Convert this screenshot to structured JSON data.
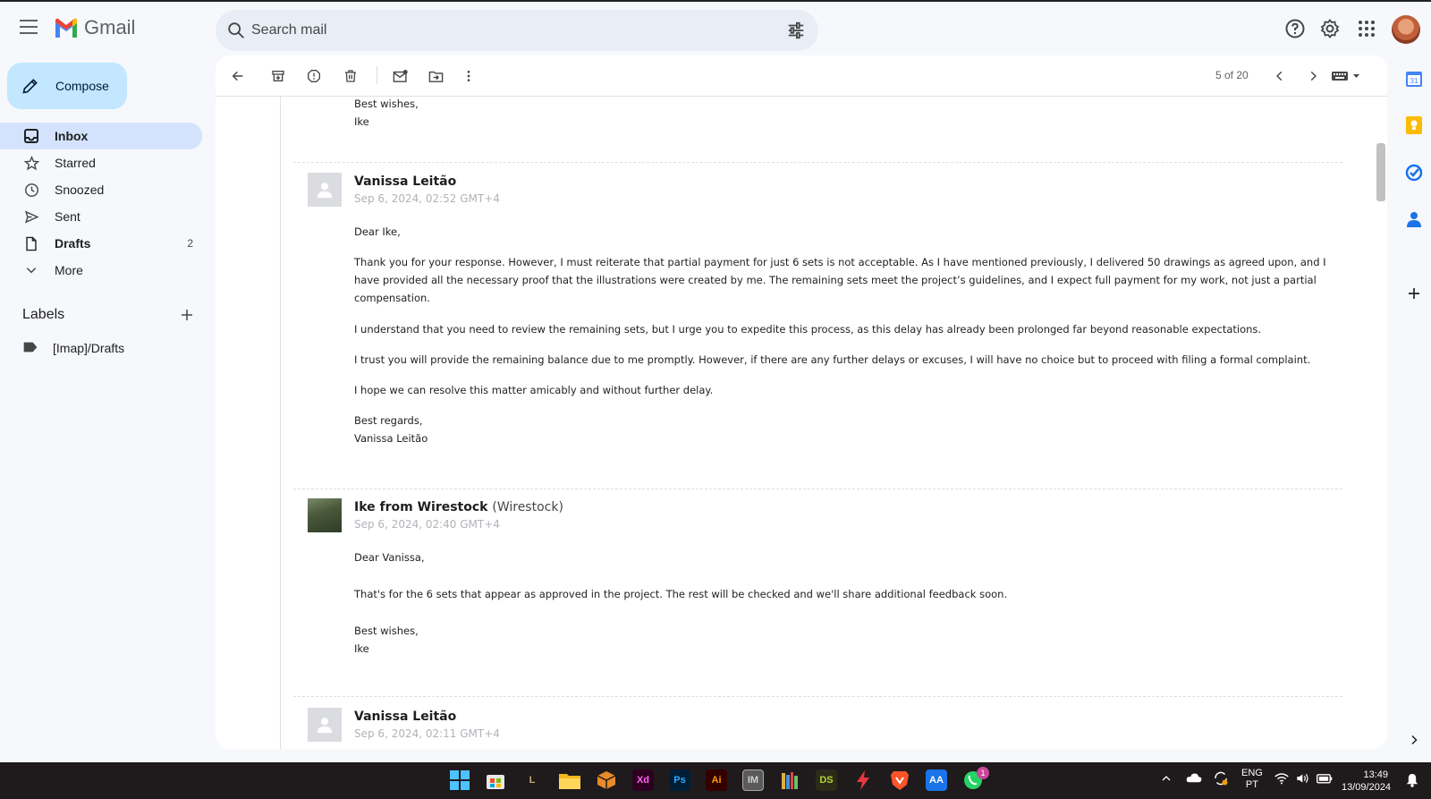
{
  "app": {
    "name": "Gmail"
  },
  "search": {
    "placeholder": "Search mail"
  },
  "compose": {
    "label": "Compose"
  },
  "nav": [
    {
      "label": "Inbox",
      "icon": "inbox-icon",
      "count": ""
    },
    {
      "label": "Starred",
      "icon": "star-icon",
      "count": ""
    },
    {
      "label": "Snoozed",
      "icon": "clock-icon",
      "count": ""
    },
    {
      "label": "Sent",
      "icon": "send-icon",
      "count": ""
    },
    {
      "label": "Drafts",
      "icon": "file-icon",
      "count": "2"
    },
    {
      "label": "More",
      "icon": "chevron-down-icon",
      "count": ""
    }
  ],
  "labels": {
    "title": "Labels",
    "items": [
      {
        "label": "[Imap]/Drafts",
        "icon": "label-icon"
      }
    ]
  },
  "toolbar": {
    "pager": "5 of 20"
  },
  "thread": {
    "top": {
      "closing": "Best wishes,",
      "signature": "Ike"
    },
    "messages": [
      {
        "sender": "Vanissa Leitão",
        "org": "",
        "date": "Sep 6, 2024, 02:52 GMT+4",
        "greeting": "Dear Ike,",
        "paragraphs": [
          "Thank you for your response. However, I must reiterate that partial payment for just 6 sets is not acceptable. As I have mentioned previously, I delivered 50 drawings as agreed upon, and I have provided all the necessary proof that the illustrations were created by me. The remaining sets meet the project’s guidelines, and I expect full payment for my work, not just a partial compensation.",
          "I understand that you need to review the remaining sets, but I urge you to expedite this process, as this delay has already been prolonged far beyond reasonable expectations.",
          "I trust you will provide the remaining balance due to me promptly. However, if there are any further delays or excuses, I will have no choice but to proceed with filing a formal complaint.",
          "I hope we can resolve this matter amicably and without further delay."
        ],
        "closing": "Best regards,",
        "signature": "Vanissa Leitão"
      },
      {
        "sender": "Ike from Wirestock",
        "org": "(Wirestock)",
        "date": "Sep 6, 2024, 02:40 GMT+4",
        "greeting": "Dear Vanissa,",
        "paragraphs": [
          "That's for the 6 sets that appear as approved in the project. The rest will be checked and we'll share additional feedback soon."
        ],
        "closing": "Best wishes,",
        "signature": "Ike"
      },
      {
        "sender": "Vanissa Leitão",
        "org": "",
        "date": "Sep 6, 2024, 02:11 GMT+4"
      }
    ]
  },
  "taskbar": {
    "apps": [
      "windows-start",
      "store",
      "league",
      "file-explorer",
      "box-app",
      "Xd",
      "Ps",
      "Ai",
      "IM",
      "library",
      "DS",
      "flash",
      "brave",
      "photo-app",
      "whatsapp"
    ],
    "whatsapp_badge": "1",
    "lang": "ENG",
    "region": "PT",
    "time": "13:49",
    "date": "13/09/2024"
  },
  "colors": {
    "accent": "#c2e7ff",
    "active_nav": "#d3e3fd",
    "taskbar": "#1f1a1c"
  }
}
